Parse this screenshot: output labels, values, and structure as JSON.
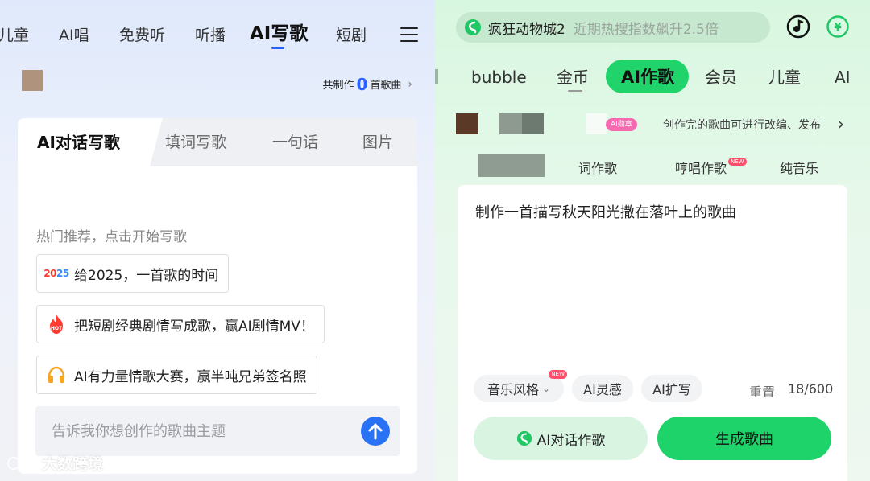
{
  "left": {
    "nav": {
      "items": [
        "儿童",
        "AI唱",
        "免费听",
        "听播",
        "AI写歌",
        "短剧"
      ],
      "active": "AI写歌"
    },
    "count": {
      "prefix": "共制作",
      "value": "0",
      "suffix": "首歌曲"
    },
    "tabs": [
      "AI对话写歌",
      "填词写歌",
      "一句话",
      "图片"
    ],
    "hot_title": "热门推荐，点击开始写歌",
    "suggestions": [
      {
        "icon": "2025-icon",
        "text": "给2025，一首歌的时间"
      },
      {
        "icon": "hot-fire-icon",
        "text": "把短剧经典剧情写成歌，赢AI剧情MV！"
      },
      {
        "icon": "headphones-icon",
        "text": "AI有力量情歌大赛，赢半吨兄弟签名照"
      }
    ],
    "input": {
      "value": "",
      "placeholder": "告诉我你想创作的歌曲主题"
    },
    "icon_2025": {
      "a": "20",
      "b": "25"
    },
    "hot_label": "HOT",
    "watermark": "大数跨境"
  },
  "right": {
    "search": {
      "hot": "疯狂动物城2",
      "hint": "近期热搜指数飙升2.5倍"
    },
    "coin_symbol": "¥",
    "nav": {
      "items": [
        "bubble",
        "金币",
        "AI作歌",
        "会员",
        "儿童",
        "AI"
      ],
      "active": "AI作歌"
    },
    "badge": "AI勋章",
    "promo": "创作完的歌曲可进行改编、发布",
    "tabs": [
      {
        "label": "词作歌",
        "new": false
      },
      {
        "label": "哼唱作歌",
        "new": true
      },
      {
        "label": "纯音乐",
        "new": false
      }
    ],
    "new_tag": "NEW",
    "prompt_text": "制作一首描写秋天阳光撒在落叶上的歌曲",
    "chips": [
      {
        "label": "音乐风格",
        "new": true
      },
      {
        "label": "AI灵感",
        "new": false
      },
      {
        "label": "AI扩写",
        "new": false
      }
    ],
    "reset_label": "重置",
    "counter": "18/600",
    "btn_chat": "AI对话作歌",
    "btn_generate": "生成歌曲"
  },
  "colors": {
    "blue_accent": "#2a62ff",
    "green_accent": "#1fd36b"
  }
}
